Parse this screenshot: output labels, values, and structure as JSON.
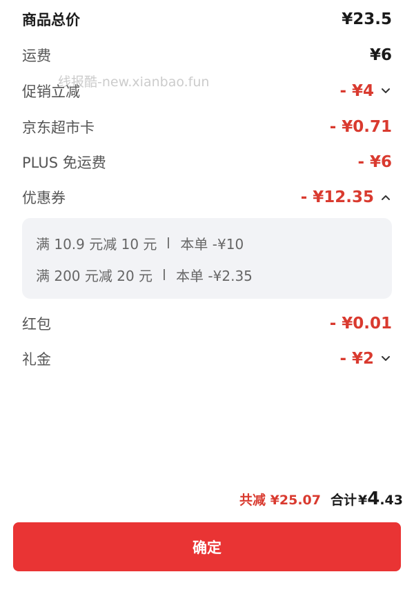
{
  "breakdown": {
    "goods_total": {
      "label": "商品总价",
      "value": "¥23.5"
    },
    "shipping": {
      "label": "运费",
      "value": "¥6"
    },
    "promo": {
      "label": "促销立减",
      "value": "- ¥4"
    },
    "jd_card": {
      "label": "京东超市卡",
      "value": "- ¥0.71"
    },
    "plus_free_ship": {
      "label": "PLUS 免运费",
      "value": "- ¥6"
    },
    "coupon": {
      "label": "优惠券",
      "value": "- ¥12.35",
      "details": [
        {
          "rule": "满 10.9 元减 10 元",
          "applied": "本单 -¥10"
        },
        {
          "rule": "满 200 元减 20 元",
          "applied": "本单 -¥2.35"
        }
      ]
    },
    "red_packet": {
      "label": "红包",
      "value": "- ¥0.01"
    },
    "gift_money": {
      "label": "礼金",
      "value": "- ¥2"
    }
  },
  "watermark": "线报酷-new.xianbao.fun",
  "summary": {
    "discount_text": "共减 ¥25.07",
    "total_label": "合计",
    "total_currency": "¥",
    "total_int": "4",
    "total_dec": ".43"
  },
  "confirm_button": {
    "label": "确定"
  },
  "colors": {
    "accent_red": "#d93a2f",
    "button_red": "#e93434",
    "panel_bg": "#f2f3f6"
  }
}
